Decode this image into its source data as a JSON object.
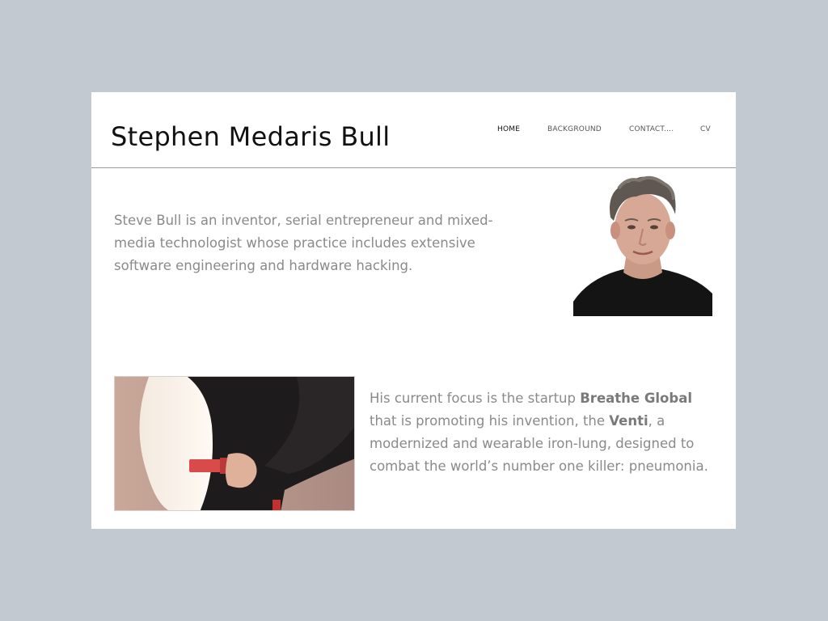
{
  "site": {
    "title": "Stephen Medaris Bull"
  },
  "nav": {
    "items": [
      {
        "label": "HOME",
        "active": true
      },
      {
        "label": "BACKGROUND",
        "active": false
      },
      {
        "label": "CONTACT....",
        "active": false
      },
      {
        "label": "CV",
        "active": false
      }
    ]
  },
  "intro": {
    "text": "Steve Bull is an inventor, serial entrepreneur and mixed-media technologist whose practice includes extensive software engineering and hardware hacking."
  },
  "focus": {
    "part1": "His current focus is the startup ",
    "company": "Breathe Global",
    "part2": " that is promoting his invention, the ",
    "product": "Venti",
    "part3": ", a modernized and wearable iron-lung, designed to combat the world’s number one killer: pneumonia."
  },
  "colors": {
    "page_background": "#c3c9d1",
    "card_background": "#ffffff",
    "body_text": "#8a8a8a",
    "title_text": "#111111"
  }
}
